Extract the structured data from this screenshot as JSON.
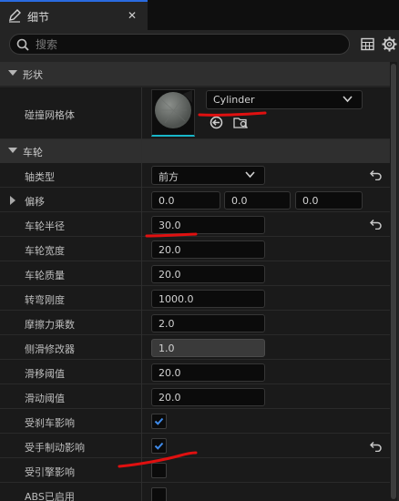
{
  "tab": {
    "title": "细节",
    "close": "✕"
  },
  "search": {
    "placeholder": "搜索",
    "value": ""
  },
  "sections": {
    "shape": {
      "label": "形状"
    },
    "wheel": {
      "label": "车轮"
    }
  },
  "collision_mesh": {
    "label": "碰撞网格体",
    "value": "Cylinder"
  },
  "properties": {
    "axle_type": {
      "label": "轴类型",
      "value": "前方"
    },
    "offset": {
      "label": "偏移",
      "x": "0.0",
      "y": "0.0",
      "z": "0.0"
    },
    "wheel_radius": {
      "label": "车轮半径",
      "value": "30.0"
    },
    "wheel_width": {
      "label": "车轮宽度",
      "value": "20.0"
    },
    "wheel_mass": {
      "label": "车轮质量",
      "value": "20.0"
    },
    "cornering_stiffness": {
      "label": "转弯刚度",
      "value": "1000.0"
    },
    "friction_multiplier": {
      "label": "摩擦力乘数",
      "value": "2.0"
    },
    "side_slip_modifier": {
      "label": "侧滑修改器",
      "value": "1.0"
    },
    "slip_threshold": {
      "label": "滑移阈值",
      "value": "20.0"
    },
    "skid_threshold": {
      "label": "滑动阈值",
      "value": "20.0"
    },
    "affected_by_brake": {
      "label": "受刹车影响",
      "checked": true
    },
    "affected_by_handbrake": {
      "label": "受手制动影响",
      "checked": true
    },
    "affected_by_engine": {
      "label": "受引擎影响",
      "checked": false
    },
    "abs_enabled": {
      "label": "ABS已启用",
      "checked": false
    }
  },
  "colors": {
    "accent": "#2a6be0",
    "annotation": "#e01010",
    "asset_underline": "#18b6c8"
  },
  "icons": [
    "pencil-icon",
    "close-icon",
    "search-icon",
    "table-icon",
    "gear-icon",
    "chevron-down-icon",
    "browse-arrow-icon",
    "find-in-browser-icon",
    "reset-arrow-icon",
    "checkmark-icon"
  ]
}
